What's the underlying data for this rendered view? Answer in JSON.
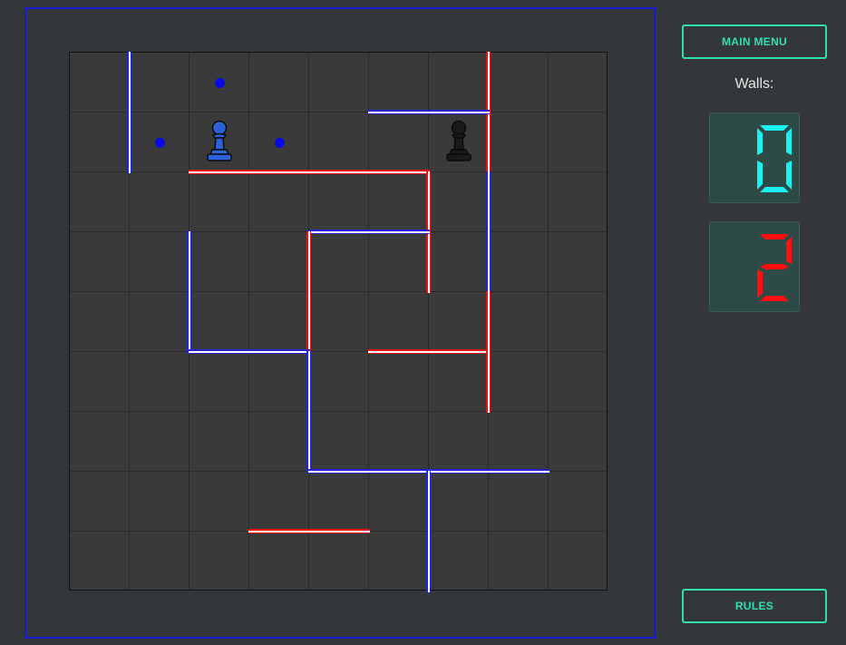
{
  "buttons": {
    "main_menu": "MAIN MENU",
    "rules": "RULES"
  },
  "walls_label": "Walls:",
  "counters": [
    {
      "player": "blue",
      "value": "0",
      "color": "#19f0f0"
    },
    {
      "player": "red",
      "value": "2",
      "color": "#ff0f0f"
    }
  ],
  "colors": {
    "frame": "#1919d6",
    "accent": "#2ee0b0",
    "blue_player": "#2424d8",
    "red_player": "#e11818"
  },
  "board": {
    "size": 9,
    "pawns": [
      {
        "player": "blue",
        "col": 2,
        "row": 1,
        "color": "#2a63d8"
      },
      {
        "player": "black",
        "col": 6,
        "row": 1,
        "color": "#1a1a1a"
      }
    ],
    "move_hints": [
      {
        "col": 2,
        "row": 0
      },
      {
        "col": 1,
        "row": 1
      },
      {
        "col": 3,
        "row": 1
      }
    ],
    "walls": [
      {
        "color": "blue",
        "orient": "v",
        "line": 1,
        "from": 0
      },
      {
        "color": "red",
        "orient": "v",
        "line": 7,
        "from": 0
      },
      {
        "color": "blue",
        "orient": "h",
        "line": 1,
        "from": 5
      },
      {
        "color": "red",
        "orient": "h",
        "line": 2,
        "from": 2
      },
      {
        "color": "red",
        "orient": "h",
        "line": 2,
        "from": 4
      },
      {
        "color": "red",
        "orient": "v",
        "line": 6,
        "from": 2
      },
      {
        "color": "blue",
        "orient": "v",
        "line": 7,
        "from": 2
      },
      {
        "color": "blue",
        "orient": "h",
        "line": 3,
        "from": 4
      },
      {
        "color": "blue",
        "orient": "v",
        "line": 2,
        "from": 3
      },
      {
        "color": "red",
        "orient": "v",
        "line": 4,
        "from": 3
      },
      {
        "color": "blue",
        "orient": "h",
        "line": 5,
        "from": 2
      },
      {
        "color": "red",
        "orient": "h",
        "line": 5,
        "from": 5
      },
      {
        "color": "red",
        "orient": "v",
        "line": 7,
        "from": 4
      },
      {
        "color": "blue",
        "orient": "v",
        "line": 4,
        "from": 5
      },
      {
        "color": "blue",
        "orient": "h",
        "line": 7,
        "from": 4
      },
      {
        "color": "blue",
        "orient": "h",
        "line": 7,
        "from": 6
      },
      {
        "color": "blue",
        "orient": "v",
        "line": 6,
        "from": 7
      },
      {
        "color": "red",
        "orient": "h",
        "line": 8,
        "from": 3
      }
    ]
  }
}
